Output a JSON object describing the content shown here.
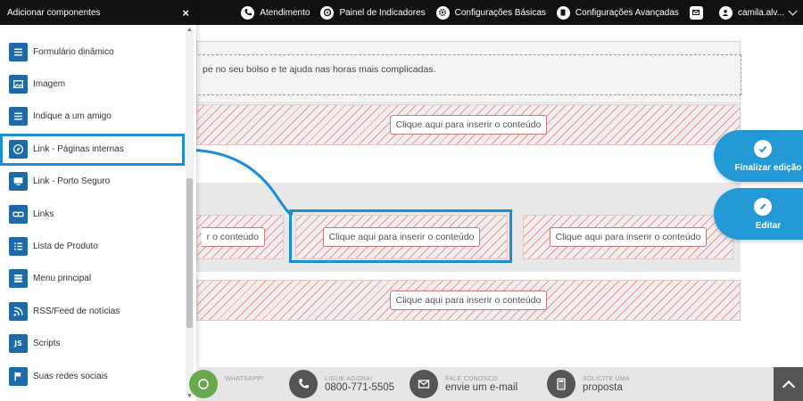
{
  "topnav": {
    "items": [
      {
        "label": "Atendimento",
        "icon": "phone-icon"
      },
      {
        "label": "Painel de Indicadores",
        "icon": "dashboard-icon"
      },
      {
        "label": "Configurações Básicas",
        "icon": "gear-icon"
      },
      {
        "label": "Configurações Avançadas",
        "icon": "document-gear-icon"
      }
    ],
    "mail_icon": "mail-icon",
    "user": "camila.alv..."
  },
  "sidebar": {
    "title": "Adicionar componentes",
    "close": "×",
    "items": [
      {
        "label": "Formulário dinâmico",
        "icon": "form-icon"
      },
      {
        "label": "Imagem",
        "icon": "image-icon"
      },
      {
        "label": "Indique a um amigo",
        "icon": "form-icon"
      },
      {
        "label": "Link - Páginas internas",
        "icon": "compass-icon"
      },
      {
        "label": "Link - Porto Seguro",
        "icon": "monitor-icon"
      },
      {
        "label": "Links",
        "icon": "link-icon"
      },
      {
        "label": "Lista de Produto",
        "icon": "list-icon"
      },
      {
        "label": "Menu principal",
        "icon": "menu-icon"
      },
      {
        "label": "RSS/Feed de notícias",
        "icon": "rss-icon"
      },
      {
        "label": "Scripts",
        "icon": "js-icon",
        "glyph": "JS"
      },
      {
        "label": "Suas redes sociais",
        "icon": "flag-icon"
      }
    ],
    "highlighted_item": "Link - Páginas internas"
  },
  "main": {
    "text_snippet": "pe no seu bolso e te ajuda nas horas mais complicadas.",
    "placeholder_full": "Clique aqui para inserir o conteúdo",
    "placeholder_cut": "r o conteúdo"
  },
  "fabs": {
    "finish": "Finalizar edição",
    "edit": "Editar"
  },
  "footer": {
    "whatsapp": {
      "caption": "WHATSAPP!"
    },
    "call": {
      "caption": "LIGUE AGORA!",
      "value": "0800-771-5505"
    },
    "contact": {
      "caption": "FALE CONOSCO",
      "value": "envie um e-mail"
    },
    "quote": {
      "caption": "SOLICITE UMA",
      "value": "proposta"
    }
  },
  "colors": {
    "accent": "#1b8fd6",
    "fab": "#2399d6",
    "topbar": "#111111",
    "hatch": "#e39b9b",
    "sidebar_icon": "#1e6aa8"
  }
}
